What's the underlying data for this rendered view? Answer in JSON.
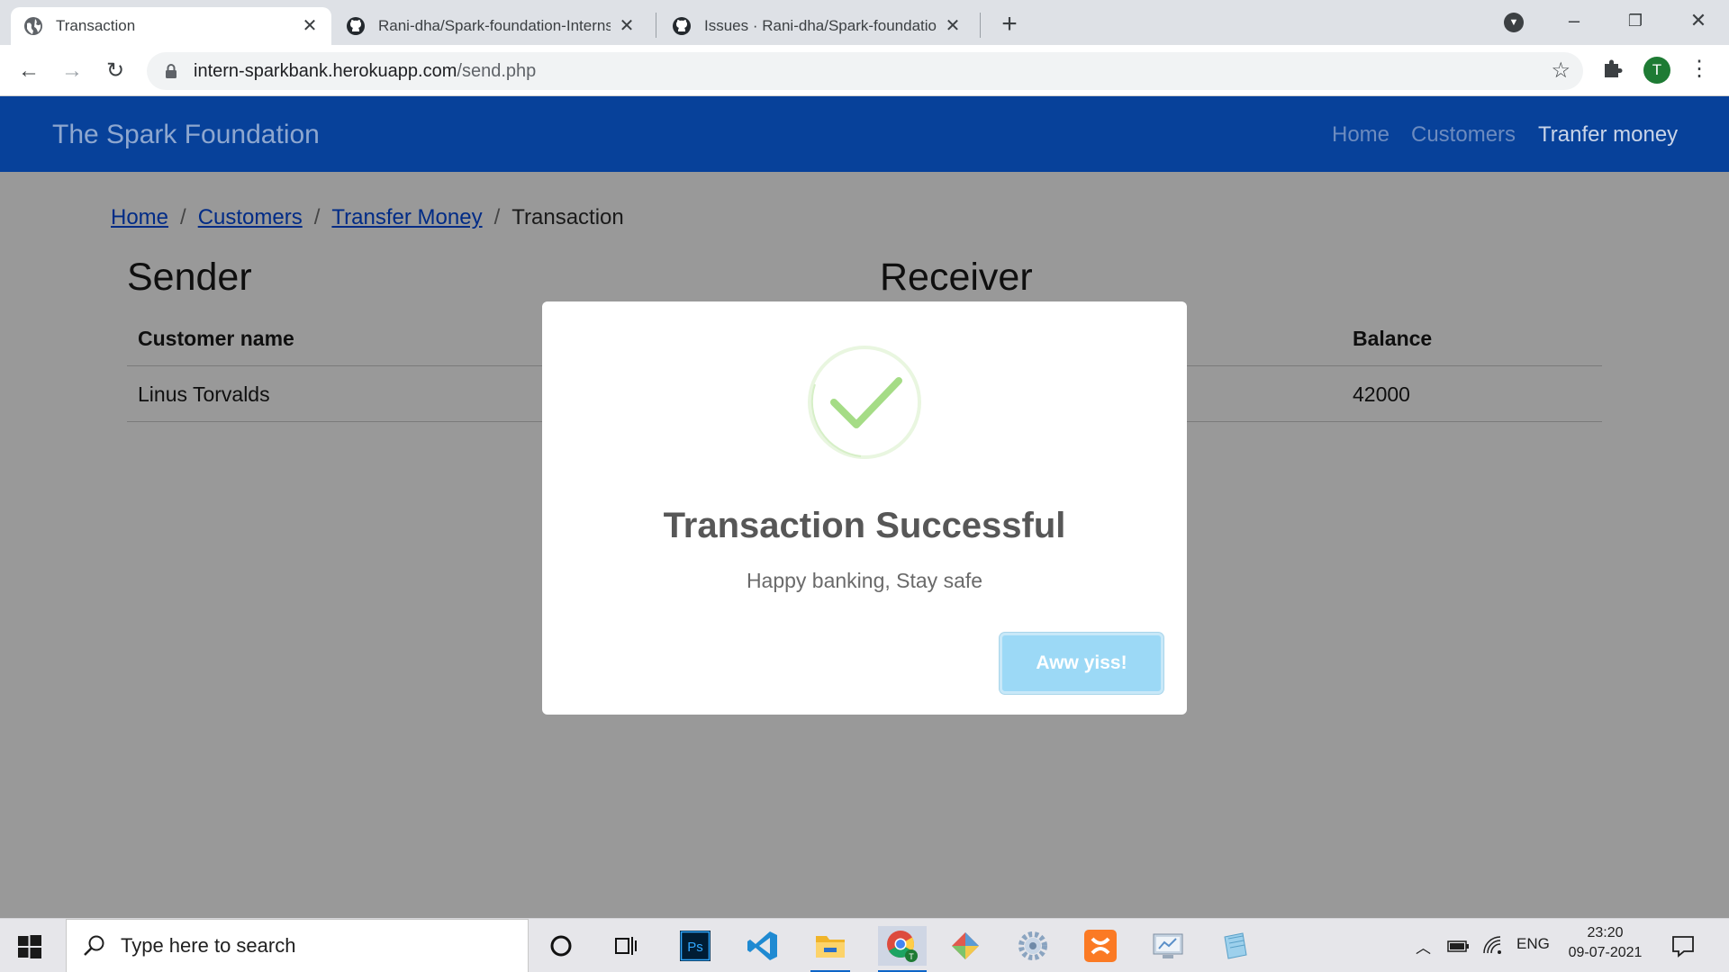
{
  "browser": {
    "tabs": [
      {
        "title": "Transaction",
        "icon": "globe-icon",
        "active": true
      },
      {
        "title": "Rani-dha/Spark-foundation-Internship",
        "icon": "github-icon",
        "active": false
      },
      {
        "title": "Issues · Rani-dha/Spark-foundation-Internship",
        "icon": "github-icon",
        "active": false
      }
    ],
    "address": {
      "host": "intern-sparkbank.herokuapp.com",
      "path": "/send.php"
    },
    "profile_initial": "T"
  },
  "site": {
    "brand": "The Spark Foundation",
    "nav": [
      {
        "label": "Home",
        "active": false
      },
      {
        "label": "Customers",
        "active": false
      },
      {
        "label": "Tranfer money",
        "active": true
      }
    ],
    "breadcrumb": [
      {
        "label": "Home",
        "link": true
      },
      {
        "label": "Customers",
        "link": true
      },
      {
        "label": "Transfer Money",
        "link": true
      },
      {
        "label": "Transaction",
        "link": false
      }
    ],
    "sender": {
      "heading": "Sender",
      "col_name": "Customer name",
      "name": "Linus Torvalds"
    },
    "receiver": {
      "heading": "Receiver",
      "col_balance": "Balance",
      "balance": "42000"
    }
  },
  "modal": {
    "title": "Transaction Successful",
    "text": "Happy banking, Stay safe",
    "button": "Aww yiss!",
    "icon": "success-check-icon",
    "accent": "#a5dc86"
  },
  "taskbar": {
    "search_placeholder": "Type here to search",
    "apps": [
      "cortana-icon",
      "task-view-icon",
      "photoshop-icon",
      "vscode-icon",
      "file-explorer-icon",
      "chrome-icon",
      "git-gui-icon",
      "settings-gear-icon",
      "xampp-icon",
      "control-panel-icon",
      "notepad-icon"
    ],
    "language": "ENG",
    "time": "23:20",
    "date": "09-07-2021"
  }
}
